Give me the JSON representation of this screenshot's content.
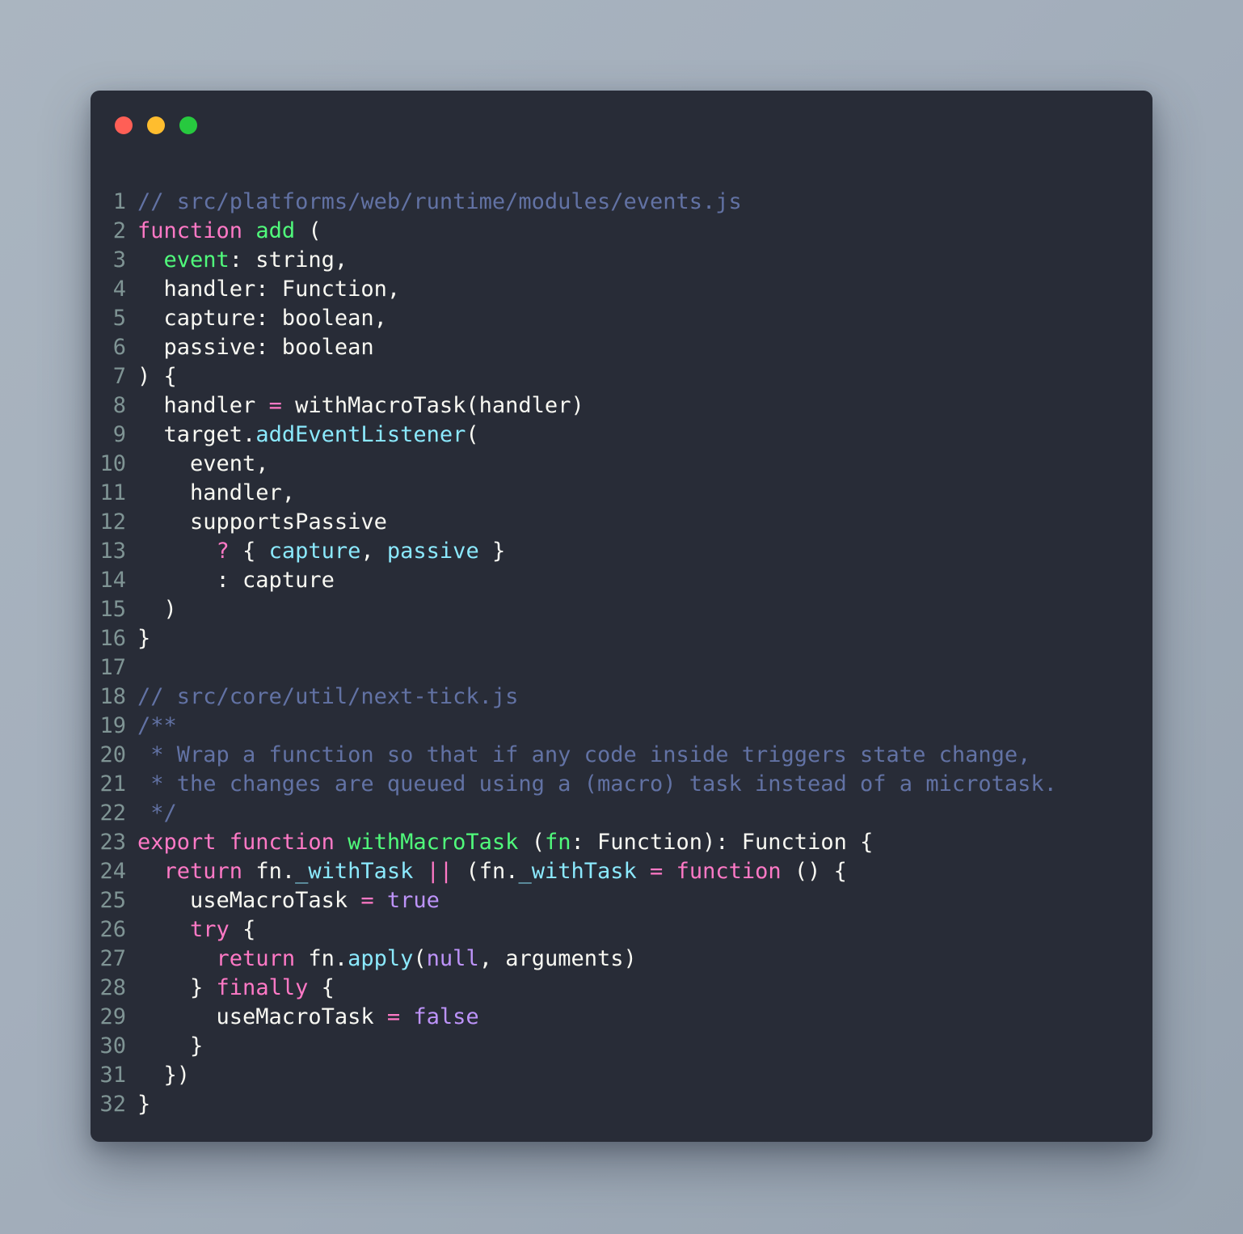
{
  "window": {
    "background": "#282c37",
    "page_background": "#a4afbc",
    "controls": [
      {
        "name": "close",
        "color": "#ff5f56"
      },
      {
        "name": "minimize",
        "color": "#ffbd2e"
      },
      {
        "name": "maximize",
        "color": "#27c93f"
      }
    ]
  },
  "palette": {
    "comment": "#6272a4",
    "keyword": "#ff79c6",
    "function": "#50fa7b",
    "property": "#8be9fd",
    "constant": "#bd93f9",
    "text": "#f8f8f2",
    "line_number": "#7f9494"
  },
  "editor": {
    "language": "javascript",
    "first_line": 1,
    "last_line": 32,
    "line_numbers": [
      "1",
      "2",
      "3",
      "4",
      "5",
      "6",
      "7",
      "8",
      "9",
      "10",
      "11",
      "12",
      "13",
      "14",
      "15",
      "16",
      "17",
      "18",
      "19",
      "20",
      "21",
      "22",
      "23",
      "24",
      "25",
      "26",
      "27",
      "28",
      "29",
      "30",
      "31",
      "32"
    ],
    "lines": [
      {
        "n": "1",
        "text": "// src/platforms/web/runtime/modules/events.js"
      },
      {
        "n": "2",
        "text": "function add ("
      },
      {
        "n": "3",
        "text": "  event: string,"
      },
      {
        "n": "4",
        "text": "  handler: Function,"
      },
      {
        "n": "5",
        "text": "  capture: boolean,"
      },
      {
        "n": "6",
        "text": "  passive: boolean"
      },
      {
        "n": "7",
        "text": ") {"
      },
      {
        "n": "8",
        "text": "  handler = withMacroTask(handler)"
      },
      {
        "n": "9",
        "text": "  target.addEventListener("
      },
      {
        "n": "10",
        "text": "    event,"
      },
      {
        "n": "11",
        "text": "    handler,"
      },
      {
        "n": "12",
        "text": "    supportsPassive"
      },
      {
        "n": "13",
        "text": "      ? { capture, passive }"
      },
      {
        "n": "14",
        "text": "      : capture"
      },
      {
        "n": "15",
        "text": "  )"
      },
      {
        "n": "16",
        "text": "}"
      },
      {
        "n": "17",
        "text": ""
      },
      {
        "n": "18",
        "text": "// src/core/util/next-tick.js"
      },
      {
        "n": "19",
        "text": "/**"
      },
      {
        "n": "20",
        "text": " * Wrap a function so that if any code inside triggers state change,"
      },
      {
        "n": "21",
        "text": " * the changes are queued using a (macro) task instead of a microtask."
      },
      {
        "n": "22",
        "text": " */"
      },
      {
        "n": "23",
        "text": "export function withMacroTask (fn: Function): Function {"
      },
      {
        "n": "24",
        "text": "  return fn._withTask || (fn._withTask = function () {"
      },
      {
        "n": "25",
        "text": "    useMacroTask = true"
      },
      {
        "n": "26",
        "text": "    try {"
      },
      {
        "n": "27",
        "text": "      return fn.apply(null, arguments)"
      },
      {
        "n": "28",
        "text": "    } finally {"
      },
      {
        "n": "29",
        "text": "      useMacroTask = false"
      },
      {
        "n": "30",
        "text": "    }"
      },
      {
        "n": "31",
        "text": "  })"
      },
      {
        "n": "32",
        "text": "}"
      }
    ],
    "tokens": {
      "1": [
        {
          "c": "com",
          "t": "// src/platforms/web/runtime/modules/events.js"
        }
      ],
      "2": [
        {
          "c": "kw",
          "t": "function"
        },
        {
          "c": "txt",
          "t": " "
        },
        {
          "c": "fn",
          "t": "add"
        },
        {
          "c": "txt",
          "t": " ("
        }
      ],
      "3": [
        {
          "c": "txt",
          "t": "  "
        },
        {
          "c": "fn",
          "t": "event"
        },
        {
          "c": "txt",
          "t": ": string,"
        }
      ],
      "4": [
        {
          "c": "txt",
          "t": "  handler: Function,"
        }
      ],
      "5": [
        {
          "c": "txt",
          "t": "  capture: boolean,"
        }
      ],
      "6": [
        {
          "c": "txt",
          "t": "  passive: boolean"
        }
      ],
      "7": [
        {
          "c": "txt",
          "t": ") {"
        }
      ],
      "8": [
        {
          "c": "txt",
          "t": "  handler "
        },
        {
          "c": "op",
          "t": "="
        },
        {
          "c": "txt",
          "t": " withMacroTask(handler)"
        }
      ],
      "9": [
        {
          "c": "txt",
          "t": "  target."
        },
        {
          "c": "prop",
          "t": "addEventListener"
        },
        {
          "c": "txt",
          "t": "("
        }
      ],
      "10": [
        {
          "c": "txt",
          "t": "    event,"
        }
      ],
      "11": [
        {
          "c": "txt",
          "t": "    handler,"
        }
      ],
      "12": [
        {
          "c": "txt",
          "t": "    supportsPassive"
        }
      ],
      "13": [
        {
          "c": "txt",
          "t": "      "
        },
        {
          "c": "op",
          "t": "?"
        },
        {
          "c": "txt",
          "t": " { "
        },
        {
          "c": "prop",
          "t": "capture"
        },
        {
          "c": "txt",
          "t": ", "
        },
        {
          "c": "prop",
          "t": "passive"
        },
        {
          "c": "txt",
          "t": " }"
        }
      ],
      "14": [
        {
          "c": "txt",
          "t": "      : capture"
        }
      ],
      "15": [
        {
          "c": "txt",
          "t": "  )"
        }
      ],
      "16": [
        {
          "c": "txt",
          "t": "}"
        }
      ],
      "17": [
        {
          "c": "txt",
          "t": ""
        }
      ],
      "18": [
        {
          "c": "com",
          "t": "// src/core/util/next-tick.js"
        }
      ],
      "19": [
        {
          "c": "com",
          "t": "/**"
        }
      ],
      "20": [
        {
          "c": "com",
          "t": " * Wrap a function so that if any code inside triggers state change,"
        }
      ],
      "21": [
        {
          "c": "com",
          "t": " * the changes are queued using a (macro) task instead of a microtask."
        }
      ],
      "22": [
        {
          "c": "com",
          "t": " */"
        }
      ],
      "23": [
        {
          "c": "kw",
          "t": "export function"
        },
        {
          "c": "txt",
          "t": " "
        },
        {
          "c": "fn",
          "t": "withMacroTask"
        },
        {
          "c": "txt",
          "t": " ("
        },
        {
          "c": "fn",
          "t": "fn"
        },
        {
          "c": "txt",
          "t": ": Function): Function {"
        }
      ],
      "24": [
        {
          "c": "txt",
          "t": "  "
        },
        {
          "c": "kw",
          "t": "return"
        },
        {
          "c": "txt",
          "t": " fn."
        },
        {
          "c": "prop",
          "t": "_withTask"
        },
        {
          "c": "txt",
          "t": " "
        },
        {
          "c": "op",
          "t": "||"
        },
        {
          "c": "txt",
          "t": " (fn."
        },
        {
          "c": "prop",
          "t": "_withTask"
        },
        {
          "c": "txt",
          "t": " "
        },
        {
          "c": "op",
          "t": "="
        },
        {
          "c": "txt",
          "t": " "
        },
        {
          "c": "kw",
          "t": "function"
        },
        {
          "c": "txt",
          "t": " () {"
        }
      ],
      "25": [
        {
          "c": "txt",
          "t": "    useMacroTask "
        },
        {
          "c": "op",
          "t": "="
        },
        {
          "c": "txt",
          "t": " "
        },
        {
          "c": "const",
          "t": "true"
        }
      ],
      "26": [
        {
          "c": "txt",
          "t": "    "
        },
        {
          "c": "kw",
          "t": "try"
        },
        {
          "c": "txt",
          "t": " {"
        }
      ],
      "27": [
        {
          "c": "txt",
          "t": "      "
        },
        {
          "c": "kw",
          "t": "return"
        },
        {
          "c": "txt",
          "t": " fn."
        },
        {
          "c": "prop",
          "t": "apply"
        },
        {
          "c": "txt",
          "t": "("
        },
        {
          "c": "const",
          "t": "null"
        },
        {
          "c": "txt",
          "t": ", arguments)"
        }
      ],
      "28": [
        {
          "c": "txt",
          "t": "    } "
        },
        {
          "c": "kw",
          "t": "finally"
        },
        {
          "c": "txt",
          "t": " {"
        }
      ],
      "29": [
        {
          "c": "txt",
          "t": "      useMacroTask "
        },
        {
          "c": "op",
          "t": "="
        },
        {
          "c": "txt",
          "t": " "
        },
        {
          "c": "const",
          "t": "false"
        }
      ],
      "30": [
        {
          "c": "txt",
          "t": "    }"
        }
      ],
      "31": [
        {
          "c": "txt",
          "t": "  })"
        }
      ],
      "32": [
        {
          "c": "txt",
          "t": "}"
        }
      ]
    }
  }
}
